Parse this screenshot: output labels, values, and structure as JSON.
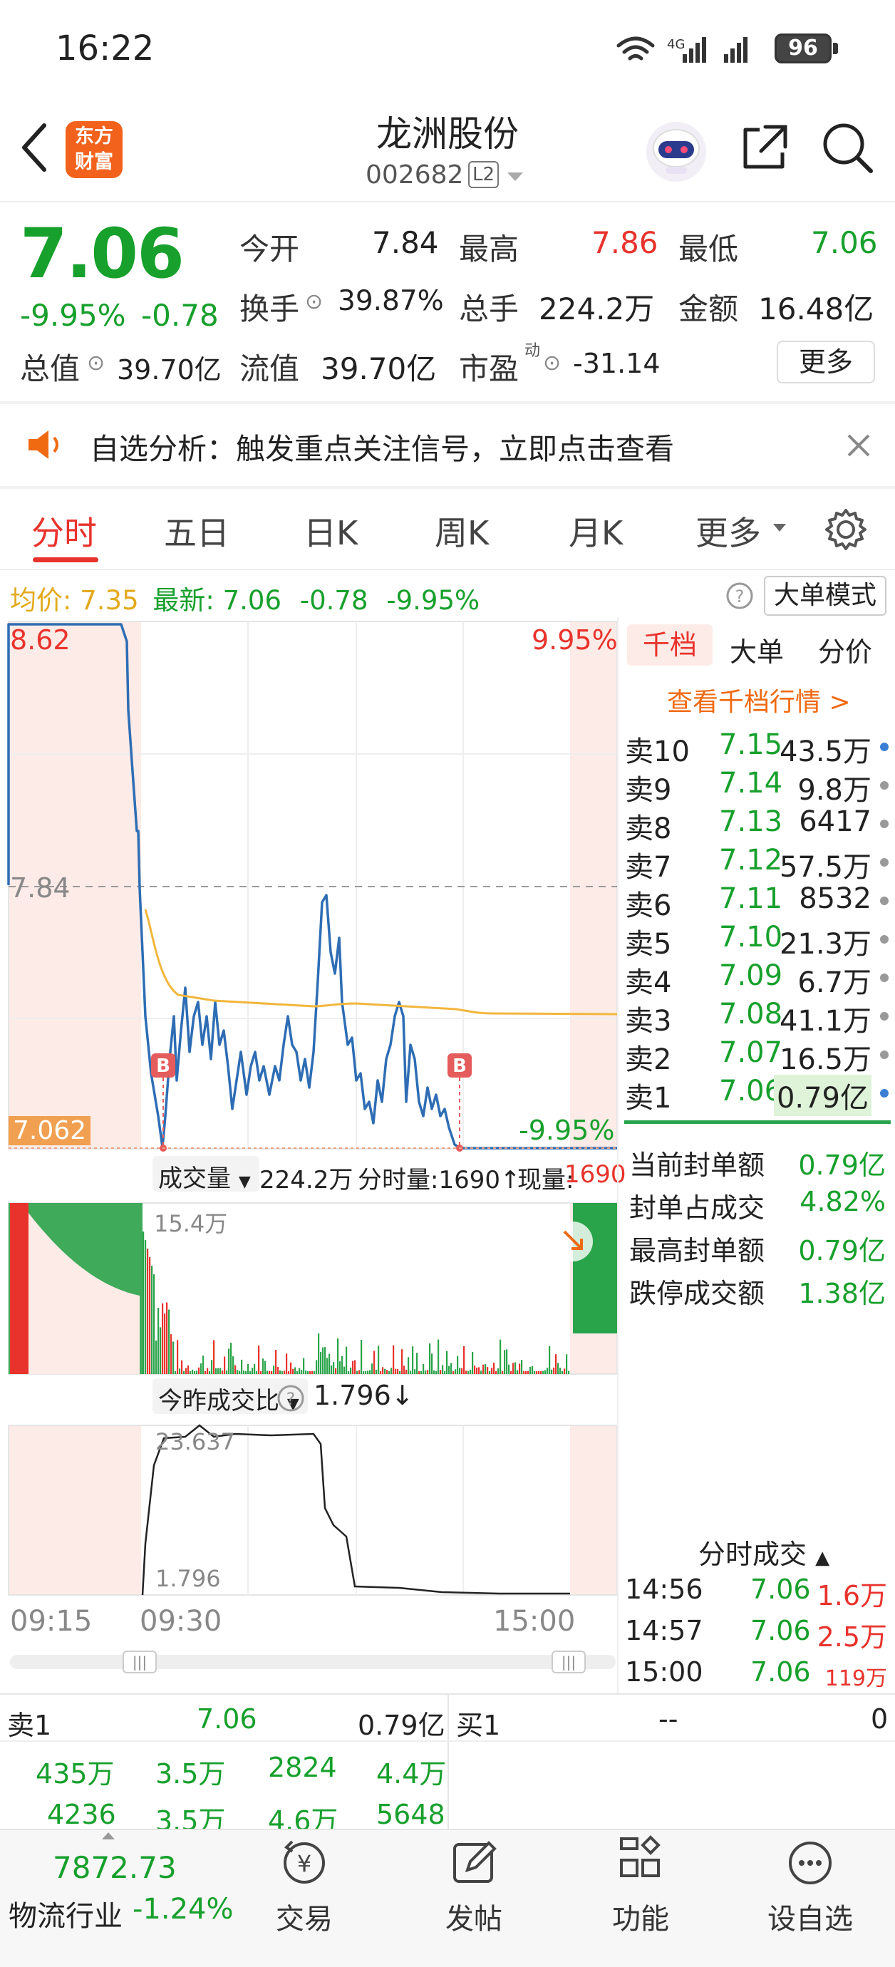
{
  "status_bar": {
    "time": "16:22",
    "battery": "96"
  },
  "header": {
    "title": "龙洲股份",
    "code": "002682",
    "level_badge": "L2",
    "logo_text": "东方财富"
  },
  "quote": {
    "price": "7.06",
    "change_pct": "-9.95%",
    "change": "-0.78",
    "open_label": "今开",
    "open": "7.84",
    "high_label": "最高",
    "high": "7.86",
    "low_label": "最低",
    "low": "7.06",
    "turnover_label": "换手",
    "turnover": "39.87%",
    "volume_label": "总手",
    "volume": "224.2万",
    "amount_label": "金额",
    "amount": "16.48亿",
    "mktcap_label": "总值",
    "mktcap": "39.70亿",
    "float_label": "流值",
    "float": "39.70亿",
    "pe_label": "市盈",
    "pe_sup": "动",
    "pe": "-31.14",
    "more_label": "更多"
  },
  "notice": {
    "text": "自选分析：触发重点关注信号，立即点击查看"
  },
  "tabs": [
    "分时",
    "五日",
    "日K",
    "周K",
    "月K",
    "更多"
  ],
  "info_row": {
    "avg_label": "均价:",
    "avg": "7.35",
    "latest_label": "最新:",
    "latest": "7.06",
    "change": "-0.78",
    "change_pct": "-9.95%",
    "big_order_mode": "大单模式"
  },
  "chart": {
    "price_high": "8.62",
    "pct_high": "9.95%",
    "prev_close": "7.84",
    "price_low": "7.062",
    "pct_low": "-9.95%",
    "vol_label": "成交量",
    "vol_total": "224.2万",
    "vol_minute": "分时量:1690↑",
    "vol_now_label": "现量:",
    "vol_now": "1690",
    "vol_max": "15.4万",
    "ratio_label": "今昨成交比",
    "ratio_value": "1.796↓",
    "ratio_max": "23.637",
    "ratio_min": "1.796",
    "time_labels": [
      "09:15",
      "09:30",
      "15:00"
    ],
    "b_marker": "B"
  },
  "chart_data": {
    "type": "line",
    "title": "",
    "series": [
      {
        "name": "",
        "x": [
          "09:15",
          "09:20",
          "09:25",
          "09:30",
          "09:35",
          "09:40",
          "09:45",
          "09:50",
          "10:00",
          "10:10",
          "10:20",
          "10:30",
          "10:45",
          "11:00",
          "11:15",
          "11:30",
          "13:00",
          "13:15",
          "13:30",
          "13:45",
          "14:00",
          "14:15",
          "14:30",
          "14:45",
          "15:00"
        ],
        "values": [
          8.62,
          8.62,
          7.84,
          7.84,
          7.2,
          7.08,
          7.3,
          7.22,
          7.15,
          7.2,
          7.25,
          7.2,
          7.35,
          7.8,
          7.4,
          7.25,
          7.15,
          7.3,
          7.2,
          7.1,
          7.06,
          7.06,
          7.06,
          7.06,
          7.06
        ]
      },
      {
        "name": "均价",
        "values": [
          7.35
        ]
      }
    ],
    "ylim": [
      7.06,
      8.62
    ],
    "reference": 7.84
  },
  "panel": {
    "tabs": [
      "千档",
      "大单",
      "分价"
    ],
    "link": "查看千档行情 >",
    "asks": [
      {
        "label": "卖10",
        "price": "7.15",
        "vol": "43.5万",
        "dot": "#3a7fd4"
      },
      {
        "label": "卖9",
        "price": "7.14",
        "vol": "9.8万",
        "dot": "#999999"
      },
      {
        "label": "卖8",
        "price": "7.13",
        "vol": "6417",
        "dot": "#999999"
      },
      {
        "label": "卖7",
        "price": "7.12",
        "vol": "57.5万",
        "dot": "#999999"
      },
      {
        "label": "卖6",
        "price": "7.11",
        "vol": "8532",
        "dot": "#999999"
      },
      {
        "label": "卖5",
        "price": "7.10",
        "vol": "21.3万",
        "dot": "#999999"
      },
      {
        "label": "卖4",
        "price": "7.09",
        "vol": "6.7万",
        "dot": "#999999"
      },
      {
        "label": "卖3",
        "price": "7.08",
        "vol": "41.1万",
        "dot": "#999999"
      },
      {
        "label": "卖2",
        "price": "7.07",
        "vol": "16.5万",
        "dot": "#999999"
      },
      {
        "label": "卖1",
        "price": "7.06",
        "vol": "0.79亿",
        "dot": "#3a7fd4"
      }
    ],
    "stats": [
      {
        "label": "当前封单额",
        "value": "0.79亿"
      },
      {
        "label": "封单占成交",
        "value": "4.82%"
      },
      {
        "label": "最高封单额",
        "value": "0.79亿"
      },
      {
        "label": "跌停成交额",
        "value": "1.38亿"
      }
    ],
    "trades_title": "分时成交",
    "trades": [
      {
        "time": "14:56",
        "price": "7.06",
        "vol": "1.6万"
      },
      {
        "time": "14:57",
        "price": "7.06",
        "vol": "2.5万"
      },
      {
        "time": "15:00",
        "price": "7.06",
        "vol": "119万"
      }
    ]
  },
  "bottom": {
    "ask_label": "卖1",
    "ask_price": "7.06",
    "ask_vol": "0.79亿",
    "bid_label": "买1",
    "bid_price": "--",
    "bid_vol": "0",
    "row1": [
      "435万",
      "3.5万",
      "2824",
      "4.4万"
    ],
    "row2": [
      "4236",
      "3.5万",
      "4.6万",
      "5648"
    ]
  },
  "footer": {
    "index_value": "7872.73",
    "index_name": "物流行业",
    "index_change": "-1.24%",
    "buttons": [
      "交易",
      "发帖",
      "功能",
      "设自选"
    ]
  }
}
